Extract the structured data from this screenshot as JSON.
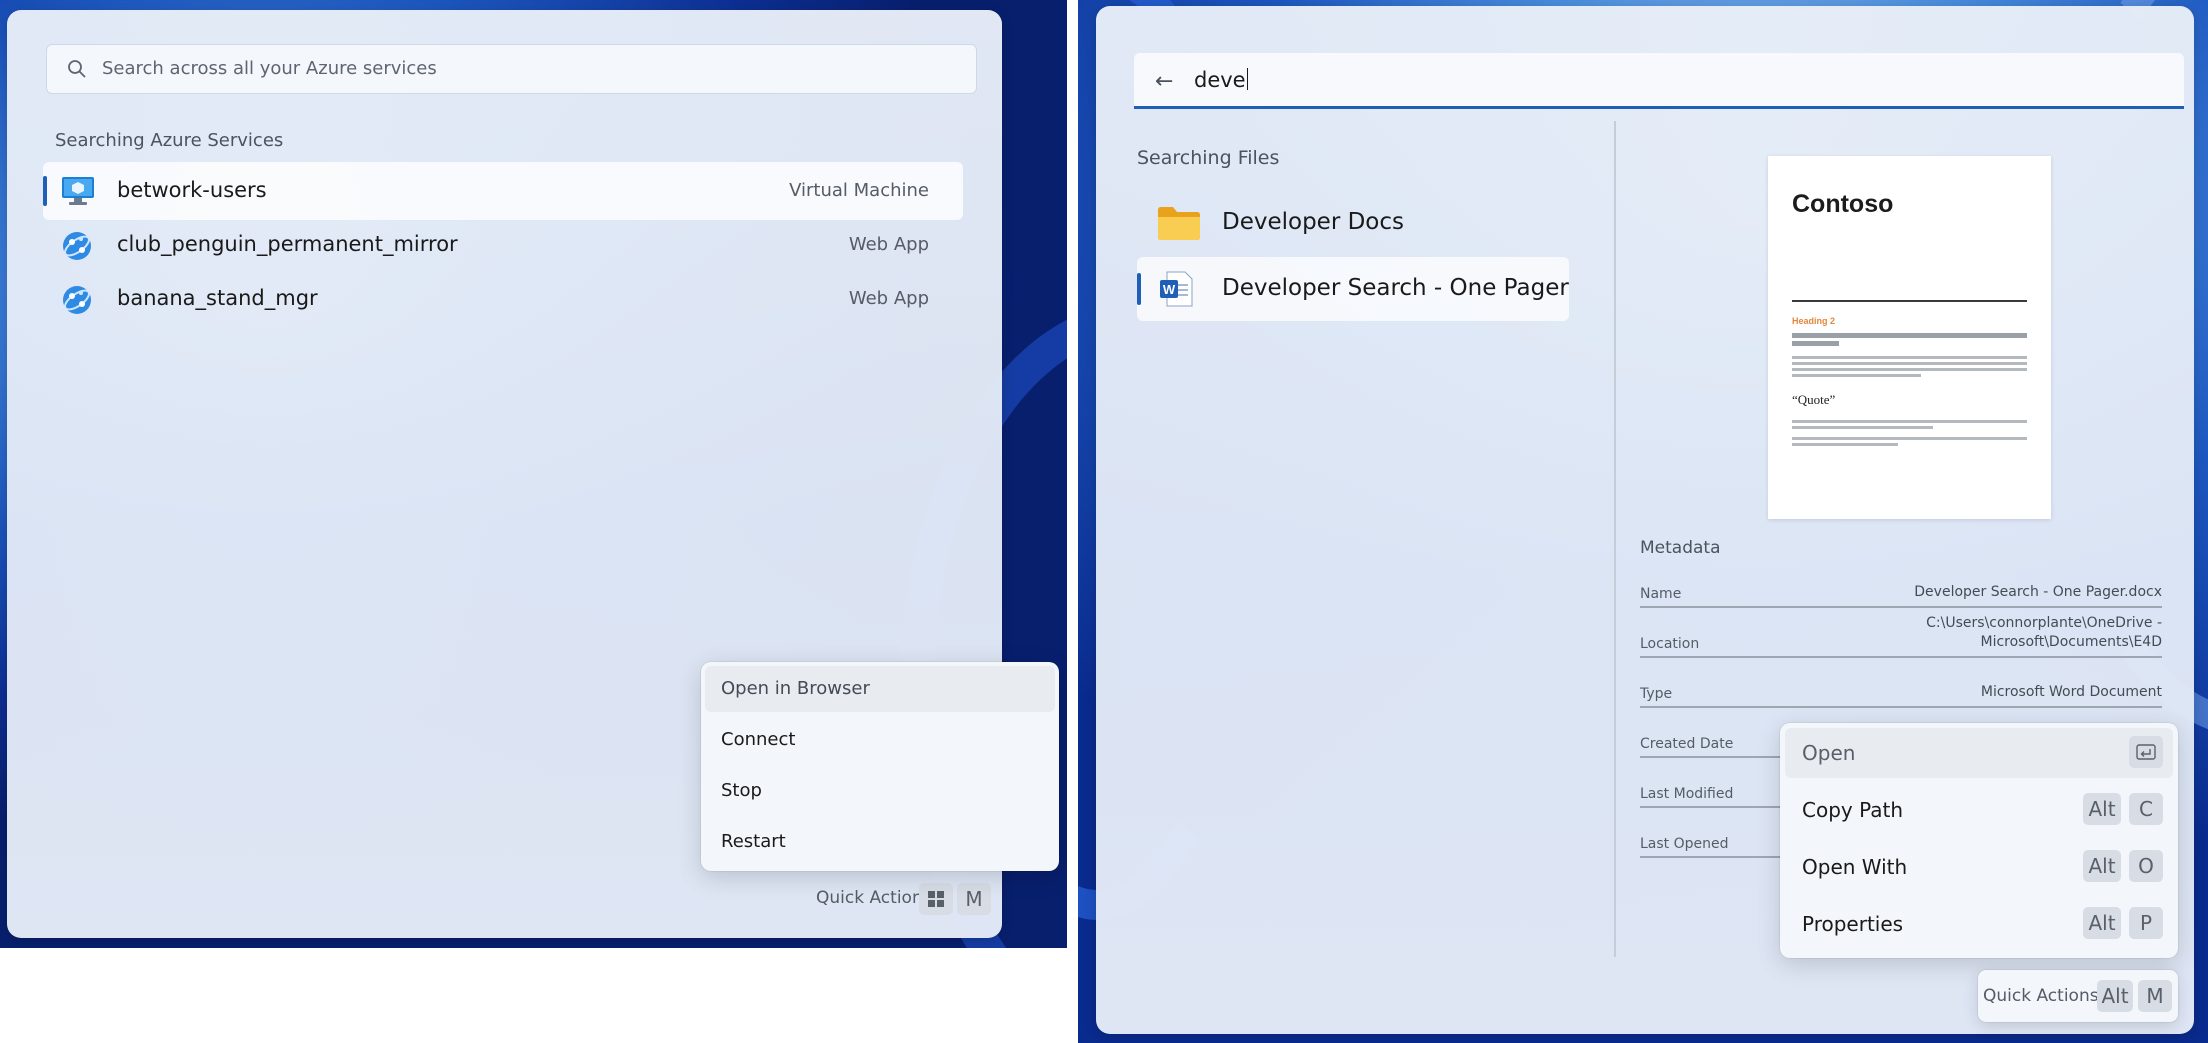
{
  "azure": {
    "search_placeholder": "Search across all your Azure services",
    "section_label": "Searching Azure Services",
    "results": [
      {
        "name": "betwork-users",
        "type": "Virtual Machine",
        "icon": "virtual-machine-icon"
      },
      {
        "name": "club_penguin_permanent_mirror",
        "type": "Web App",
        "icon": "web-app-icon"
      },
      {
        "name": "banana_stand_mgr",
        "type": "Web App",
        "icon": "web-app-icon"
      }
    ],
    "context_menu": [
      "Open in Browser",
      "Connect",
      "Stop",
      "Restart"
    ],
    "quick_actions": {
      "label": "Quick Actions",
      "keys": [
        "windows-key-icon",
        "M"
      ]
    }
  },
  "files": {
    "query": "deve",
    "section_label": "Searching Files",
    "results": [
      {
        "name": "Developer Docs",
        "icon": "folder-icon"
      },
      {
        "name": "Developer Search - One Pager",
        "icon": "word-doc-icon"
      }
    ],
    "preview": {
      "brand": "Contoso",
      "heading": "Heading 2",
      "quote": "“Quote”"
    },
    "metadata": {
      "title": "Metadata",
      "rows": [
        {
          "key": "Name",
          "value": "Developer Search - One Pager.docx"
        },
        {
          "key": "Location",
          "value": "C:\\Users\\connorplante\\OneDrive - Microsoft\\Documents\\E4D"
        },
        {
          "key": "Type",
          "value": "Microsoft Word Document"
        },
        {
          "key": "Created Date",
          "value": ""
        },
        {
          "key": "Last Modified",
          "value": ""
        },
        {
          "key": "Last Opened",
          "value": ""
        }
      ]
    },
    "context_menu": [
      {
        "label": "Open",
        "keys": [
          "enter-key-icon"
        ]
      },
      {
        "label": "Copy Path",
        "keys": [
          "Alt",
          "C"
        ]
      },
      {
        "label": "Open With",
        "keys": [
          "Alt",
          "O"
        ]
      },
      {
        "label": "Properties",
        "keys": [
          "Alt",
          "P"
        ]
      }
    ],
    "quick_actions": {
      "label": "Quick Actions",
      "keys": [
        "Alt",
        "M"
      ]
    }
  },
  "colors": {
    "accent": "#1f5fb8",
    "wallpaper_dark": "#0d2f93",
    "wallpaper_light": "#a9cdf2"
  }
}
